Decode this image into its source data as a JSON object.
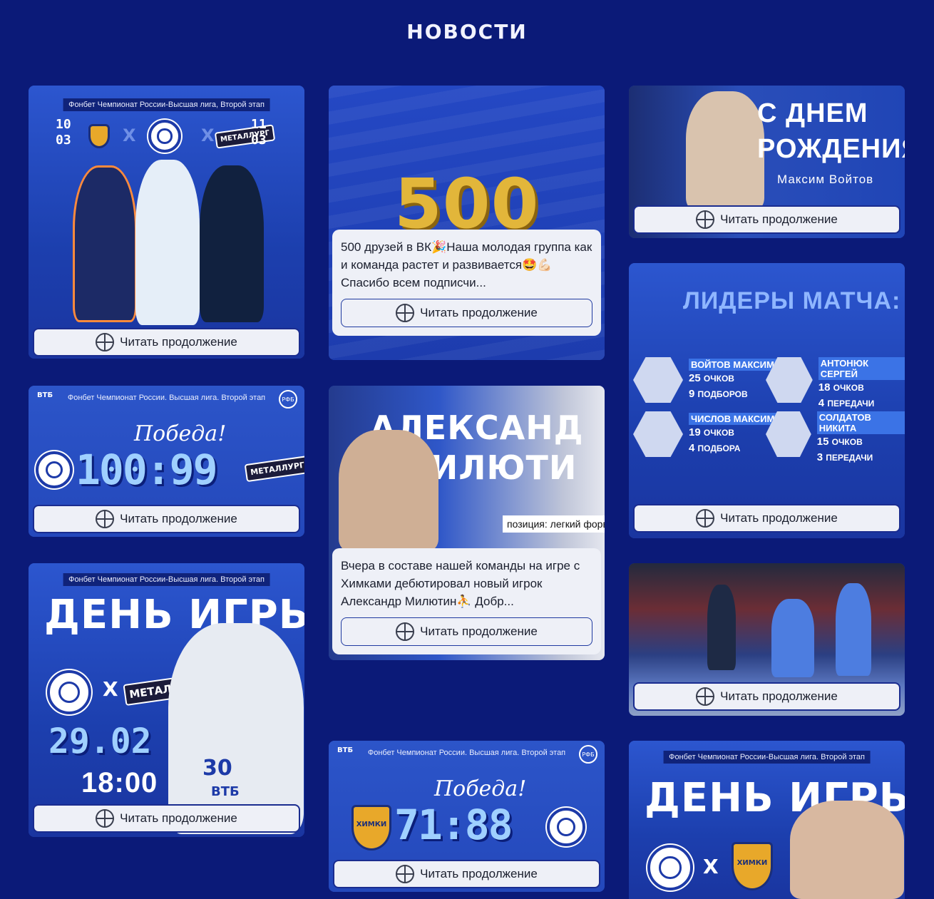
{
  "page": {
    "title": "НОВОСТИ"
  },
  "read_more_label": "Читать продолжение",
  "cards": {
    "c1": {
      "league": "Фонбет Чемпионат России-Высшая лига, Второй этап",
      "date_left": "10\n03",
      "date_right": "11\n03",
      "vs": "X"
    },
    "c2": {
      "big_number": "500",
      "excerpt": "500 друзей в ВК🎉Наша молодая группа как и команда растет и развивается🤩💪🏻 Спасибо всем подписчи..."
    },
    "c3": {
      "headline": "С ДНЕМ РОЖДЕНИЯ",
      "subline": "Максим Войтов"
    },
    "c4": {
      "title": "ЛИДЕРЫ МАТЧА:",
      "leaders": [
        {
          "name": "ВОЙТОВ МАКСИМ",
          "s1v": "25",
          "s1": "ОЧКОВ",
          "s2v": "9",
          "s2": "ПОДБОРОВ"
        },
        {
          "name": "АНТОНЮК СЕРГЕЙ",
          "s1v": "18",
          "s1": "ОЧКОВ",
          "s2v": "4",
          "s2": "ПЕРЕДАЧИ"
        },
        {
          "name": "ЧИСЛОВ МАКСИМ",
          "s1v": "19",
          "s1": "ОЧКОВ",
          "s2v": "4",
          "s2": "ПОДБОРА"
        },
        {
          "name": "СОЛДАТОВ НИКИТА",
          "s1v": "15",
          "s1": "ОЧКОВ",
          "s2v": "3",
          "s2": "ПЕРЕДАЧИ"
        }
      ]
    },
    "c5": {
      "vtb": "ВТБ",
      "league": "Фонбет Чемпионат России. Высшая лига. Второй этап",
      "rfb": "РФБ",
      "pobeda": "Победа!",
      "score": "100:99",
      "opponent": "МЕТАЛЛУРГ"
    },
    "c6": {
      "name_line1": "АЛЕКСАНД",
      "name_line2": "МИЛЮТИ",
      "position": "позиция: легкий форва",
      "excerpt": "Вчера в составе нашей команды на игре с Химками дебютировал новый игрок Александр Милютин⛹️ Добр..."
    },
    "c7": {
      "league": "Фонбет Чемпионат России-Высшая лига. Второй этап",
      "headline": "ДЕНЬ ИГРЫ",
      "opponent": "МЕТАЛЛУРГ",
      "vs": "X",
      "date": "29.02",
      "time": "18:00",
      "jersey": "30",
      "sponsor": "ВТБ"
    },
    "c8": {},
    "c9": {
      "vtb": "ВТБ",
      "league": "Фонбет Чемпионат России. Высшая лига. Второй этап",
      "rfb": "РФБ",
      "pobeda": "Победа!",
      "score": "71:88",
      "opponent": "ХИМКИ"
    },
    "c10": {
      "league": "Фонбет Чемпионат России-Высшая лига. Второй этап",
      "headline": "ДЕНЬ ИГРЫ",
      "vs": "X",
      "opponent": "ХИМКИ"
    }
  }
}
